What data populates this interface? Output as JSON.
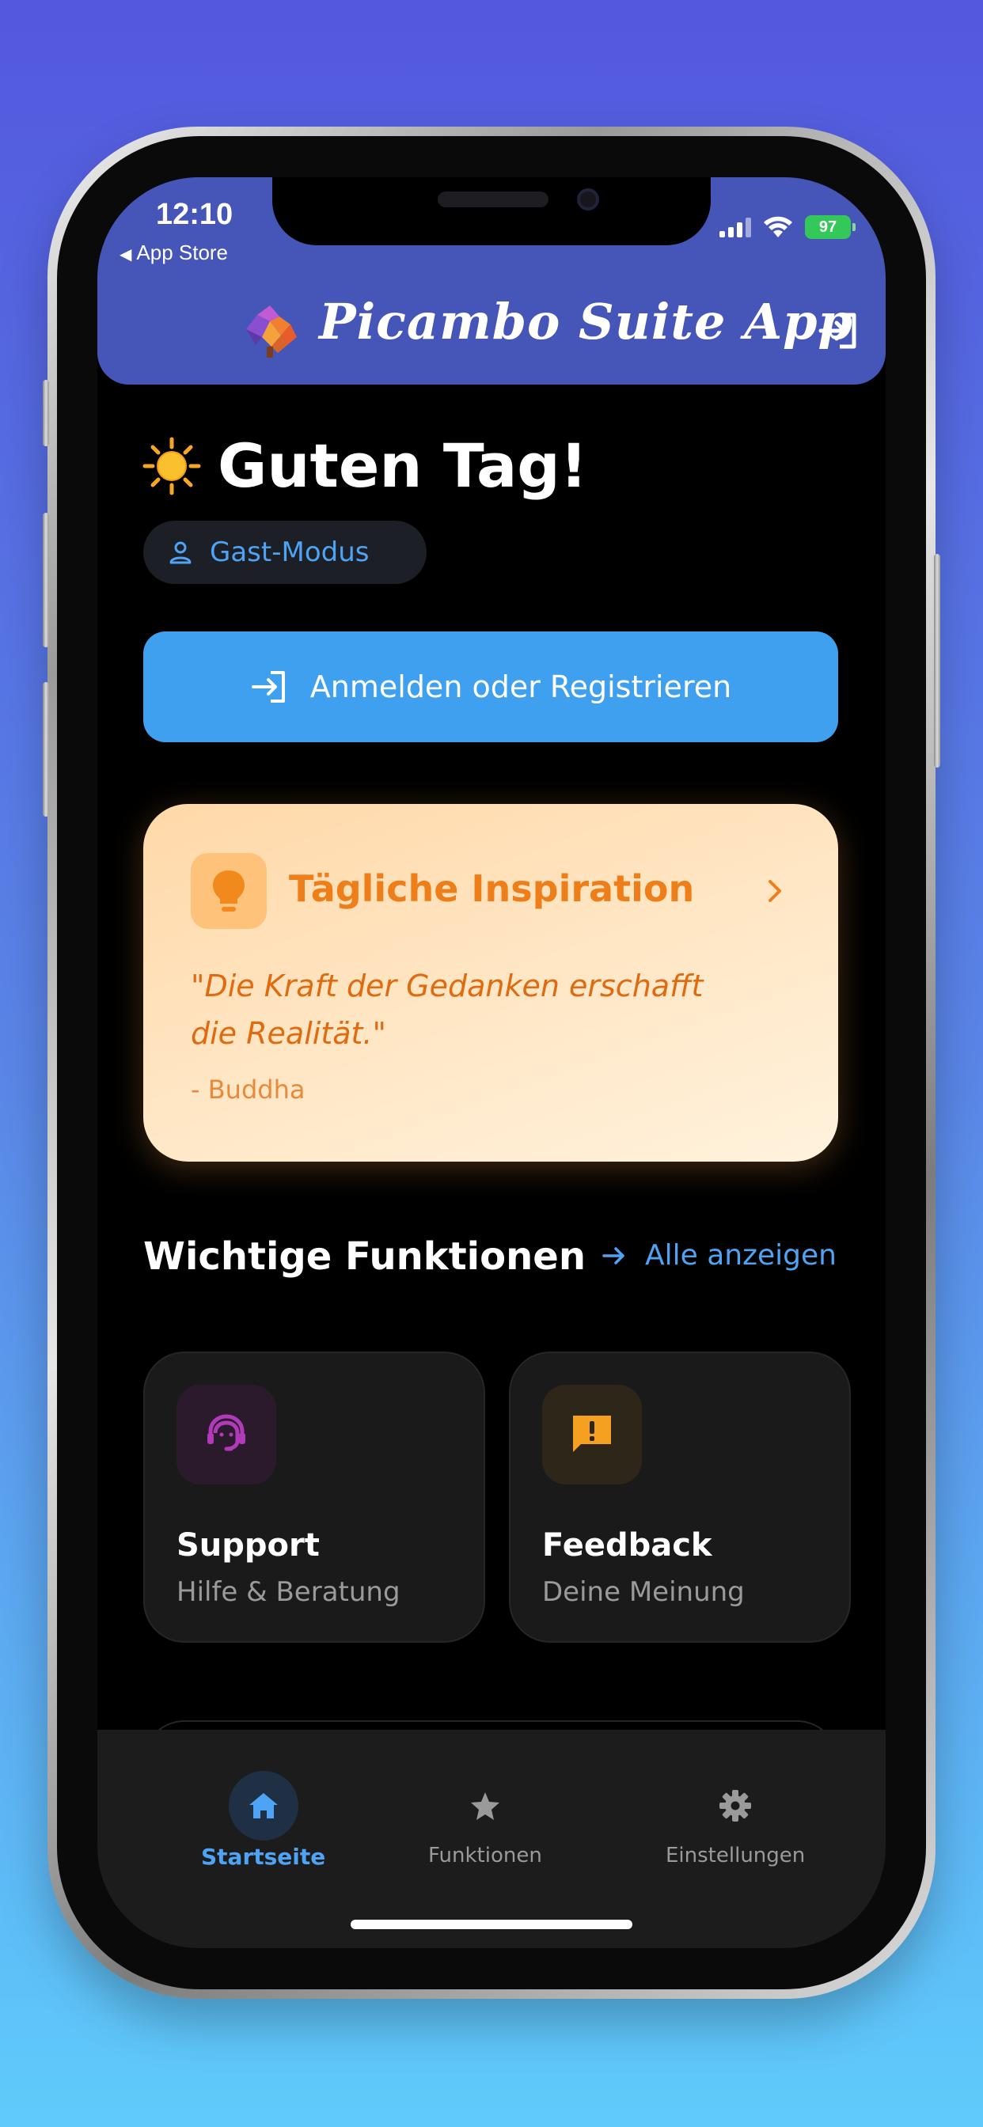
{
  "status_bar": {
    "time": "12:10",
    "back_label": "App Store",
    "battery": "97"
  },
  "header": {
    "title": "Picambo Suite App"
  },
  "greeting": {
    "text": "Guten Tag!"
  },
  "guest_badge": {
    "label": "Gast-Modus"
  },
  "login_button": {
    "label": "Anmelden oder Registrieren"
  },
  "inspiration": {
    "title": "Tägliche Inspiration",
    "quote": "\"Die Kraft der Gedanken erschafft die Realität.\"",
    "author": "- Buddha"
  },
  "features": {
    "title": "Wichtige Funktionen",
    "see_all": "Alle anzeigen",
    "cards": [
      {
        "title": "Support",
        "subtitle": "Hilfe & Beratung",
        "icon": "support-agent-icon",
        "color": "#b03ab8"
      },
      {
        "title": "Feedback",
        "subtitle": "Deine Meinung",
        "icon": "feedback-icon",
        "color": "#f5a020"
      }
    ]
  },
  "tabbar": {
    "items": [
      {
        "label": "Startseite",
        "icon": "home-icon",
        "active": true
      },
      {
        "label": "Funktionen",
        "icon": "star-icon",
        "active": false
      },
      {
        "label": "Einstellungen",
        "icon": "gear-icon",
        "active": false
      }
    ]
  },
  "colors": {
    "accent": "#40a0f0",
    "header": "#4656b8",
    "inspiration": "#ee7e1a"
  }
}
